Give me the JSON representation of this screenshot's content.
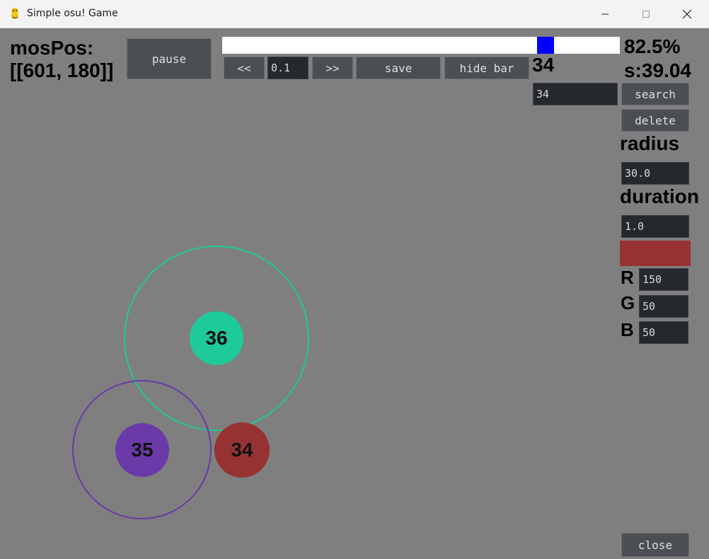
{
  "window": {
    "title": "Simple osu! Game"
  },
  "hud": {
    "mouse_label": "mosPos:",
    "mouse_value": "[[601, 180]]",
    "pause_label": "pause",
    "progress_fraction": 0.825,
    "progress_percent": "82.5%",
    "seconds": "s:39.04"
  },
  "toolbar": {
    "rewind_label": "<<",
    "step_value": "0.1",
    "forward_label": ">>",
    "save_label": "save",
    "hide_bar_label": "hide bar"
  },
  "editor": {
    "selected_id": "34",
    "search_value": "34",
    "search_label": "search",
    "delete_label": "delete",
    "radius_label": "radius",
    "radius_value": "30.0",
    "duration_label": "duration",
    "duration_value": "1.0",
    "color_swatch": "#963232",
    "r_label": "R",
    "r_value": "150",
    "g_label": "G",
    "g_value": "50",
    "b_label": "B",
    "b_value": "50",
    "close_label": "close"
  },
  "hit_objects": [
    {
      "id": "36",
      "color": "#1ec99a",
      "ring_color": "#1ec99a"
    },
    {
      "id": "35",
      "color": "#6a3aa8",
      "ring_color": "#6a3aa8"
    },
    {
      "id": "34",
      "color": "#963232"
    }
  ]
}
